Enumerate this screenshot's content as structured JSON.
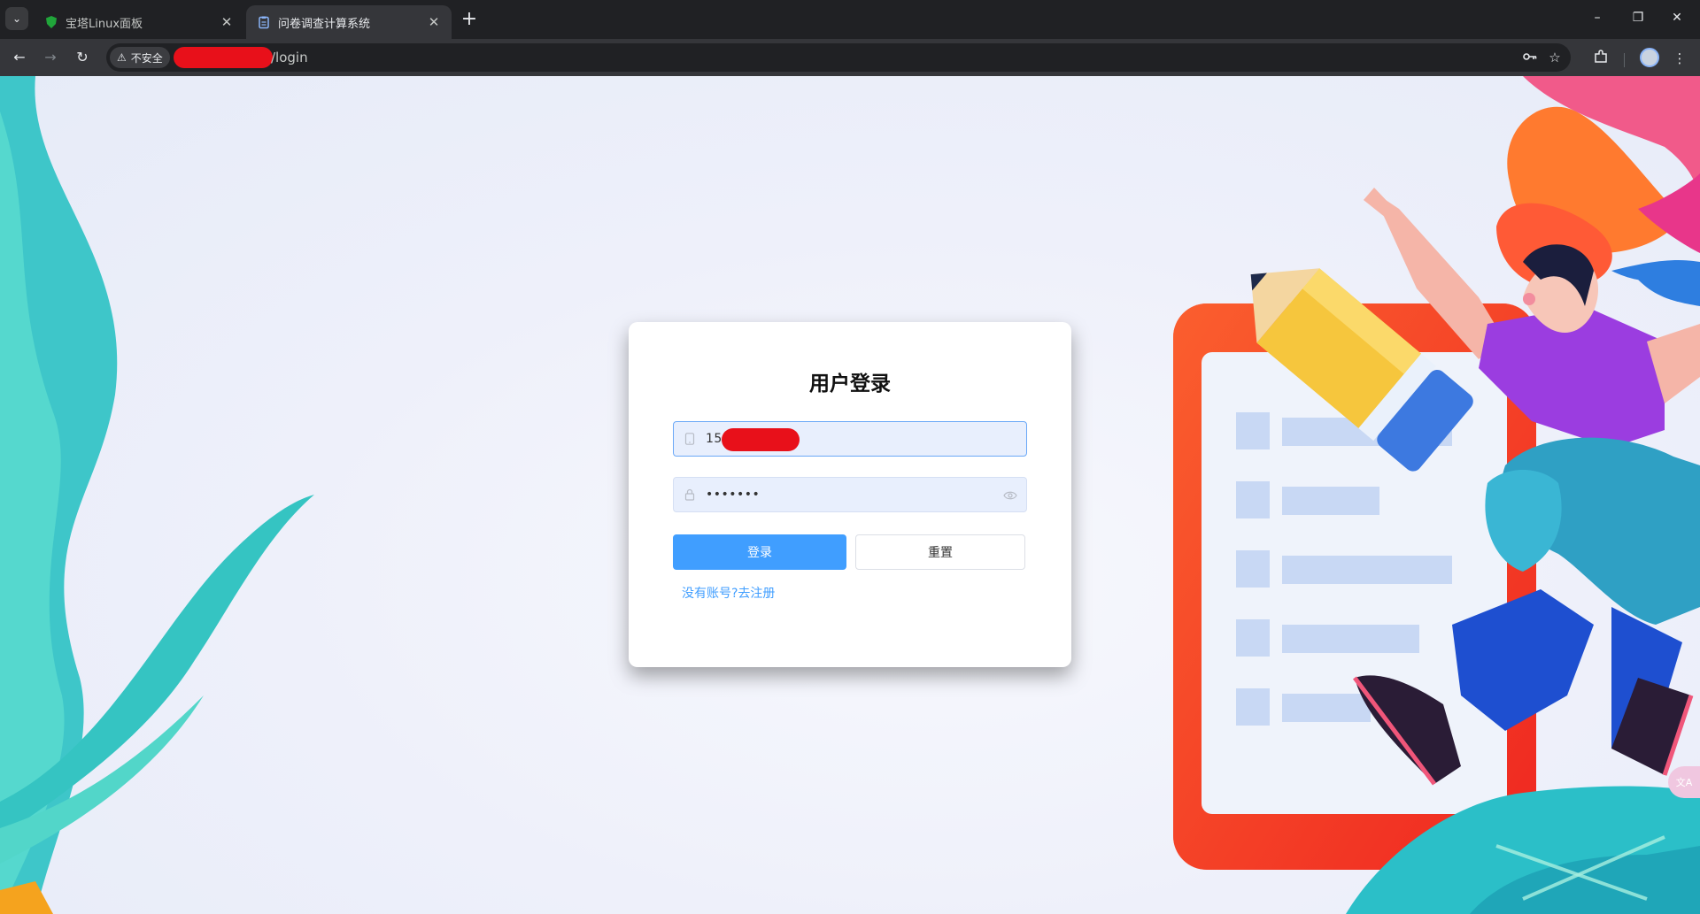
{
  "browser": {
    "tabs": [
      {
        "title": "宝塔Linux面板",
        "active": false,
        "favicon": "shield-favicon"
      },
      {
        "title": "问卷调查计算系统",
        "active": true,
        "favicon": "clipboard-favicon"
      }
    ],
    "security_label": "不安全",
    "url_path": "/login",
    "new_tab": "+",
    "window_controls": {
      "minimize": "–",
      "restore": "❐",
      "close": "✕"
    },
    "icons": [
      "back-icon",
      "forward-icon",
      "reload-icon",
      "password-key-icon",
      "bookmark-star-icon",
      "extensions-icon",
      "profile-avatar",
      "menu-icon"
    ]
  },
  "login": {
    "title": "用户登录",
    "username_value": "156",
    "password_value": "•••••••",
    "login_button": "登录",
    "reset_button": "重置",
    "register_link": "没有账号?去注册"
  },
  "translate_badge": "文A",
  "colors": {
    "primary": "#409eff",
    "input_bg": "#e8effd",
    "redaction": "#e8101a"
  }
}
